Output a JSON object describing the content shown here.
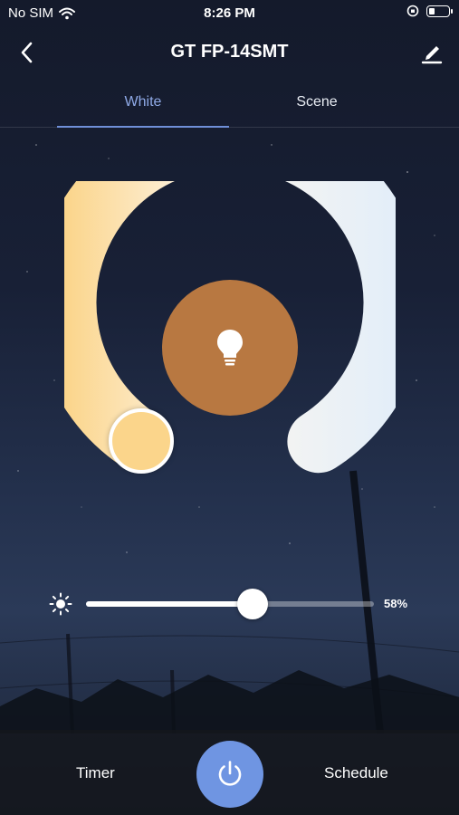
{
  "status_bar": {
    "carrier": "No SIM",
    "time": "8:26 PM"
  },
  "header": {
    "title": "GT FP-14SMT",
    "back_icon": "chevron-left-icon",
    "edit_icon": "pencil-icon"
  },
  "tabs": [
    {
      "label": "White",
      "active": true
    },
    {
      "label": "Scene",
      "active": false
    }
  ],
  "dial": {
    "center_icon": "lightbulb-icon",
    "warm_color": "#fbd58b",
    "cool_color": "#e6f0fb"
  },
  "brightness": {
    "value": 58,
    "label": "58%"
  },
  "bottom_bar": {
    "timer_label": "Timer",
    "schedule_label": "Schedule",
    "power_color": "#6f95e2"
  }
}
